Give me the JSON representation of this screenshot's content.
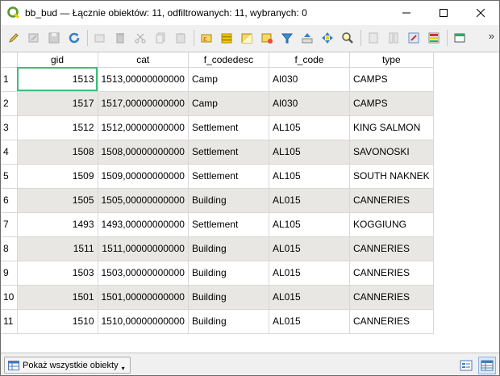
{
  "window": {
    "title": "bb_bud — Łącznie obiektów: 11, odfiltrowanych: 11, wybranych: 0",
    "minimize_glyph": "—",
    "maximize_glyph": "☐",
    "close_glyph": "✕"
  },
  "toolbar": {
    "more_glyph": "»",
    "icons": [
      "edit-pencil-icon",
      "multi-edit-icon",
      "save-edits-icon",
      "reload-icon",
      "add-feature-icon",
      "delete-feature-icon",
      "cut-icon",
      "copy-icon",
      "paste-icon",
      "expression-select-icon",
      "select-all-icon",
      "invert-selection-icon",
      "deselect-all-icon",
      "filter-icon",
      "move-selection-top-icon",
      "pan-to-selection-icon",
      "zoom-to-selection-icon",
      "new-field-icon",
      "delete-field-icon",
      "field-calculator-icon",
      "conditional-formatting-icon",
      "dock-icon"
    ]
  },
  "table": {
    "columns": [
      "gid",
      "cat",
      "f_codedesc",
      "f_code",
      "type"
    ],
    "rows": [
      {
        "n": "1",
        "gid": "1513",
        "cat": "1513,00000000000",
        "f_codedesc": "Camp",
        "f_code": "AI030",
        "type": "CAMPS"
      },
      {
        "n": "2",
        "gid": "1517",
        "cat": "1517,00000000000",
        "f_codedesc": "Camp",
        "f_code": "AI030",
        "type": "CAMPS"
      },
      {
        "n": "3",
        "gid": "1512",
        "cat": "1512,00000000000",
        "f_codedesc": "Settlement",
        "f_code": "AL105",
        "type": "KING SALMON"
      },
      {
        "n": "4",
        "gid": "1508",
        "cat": "1508,00000000000",
        "f_codedesc": "Settlement",
        "f_code": "AL105",
        "type": "SAVONOSKI"
      },
      {
        "n": "5",
        "gid": "1509",
        "cat": "1509,00000000000",
        "f_codedesc": "Settlement",
        "f_code": "AL105",
        "type": "SOUTH NAKNEK"
      },
      {
        "n": "6",
        "gid": "1505",
        "cat": "1505,00000000000",
        "f_codedesc": "Building",
        "f_code": "AL015",
        "type": "CANNERIES"
      },
      {
        "n": "7",
        "gid": "1493",
        "cat": "1493,00000000000",
        "f_codedesc": "Settlement",
        "f_code": "AL105",
        "type": "KOGGIUNG"
      },
      {
        "n": "8",
        "gid": "1511",
        "cat": "1511,00000000000",
        "f_codedesc": "Building",
        "f_code": "AL015",
        "type": "CANNERIES"
      },
      {
        "n": "9",
        "gid": "1503",
        "cat": "1503,00000000000",
        "f_codedesc": "Building",
        "f_code": "AL015",
        "type": "CANNERIES"
      },
      {
        "n": "10",
        "gid": "1501",
        "cat": "1501,00000000000",
        "f_codedesc": "Building",
        "f_code": "AL015",
        "type": "CANNERIES"
      },
      {
        "n": "11",
        "gid": "1510",
        "cat": "1510,00000000000",
        "f_codedesc": "Building",
        "f_code": "AL015",
        "type": "CANNERIES"
      }
    ]
  },
  "statusbar": {
    "show_all_label": "Pokaż wszystkie obiekty"
  }
}
